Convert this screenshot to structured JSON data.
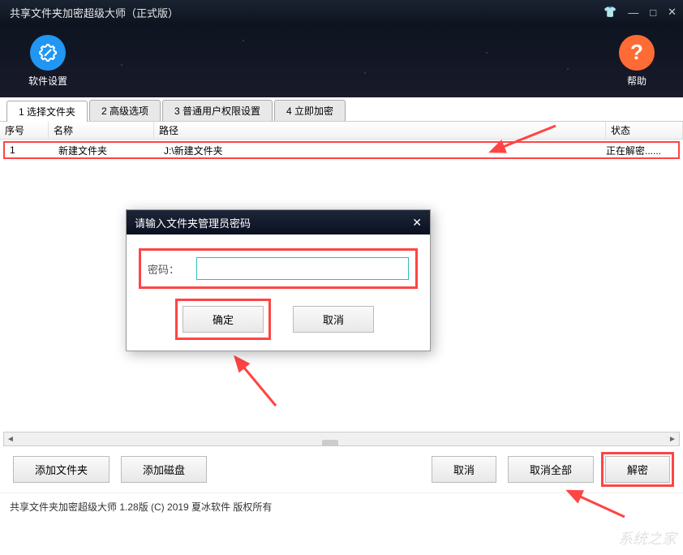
{
  "titlebar": {
    "title": "共享文件夹加密超级大师（正式版）"
  },
  "header": {
    "settings_label": "软件设置",
    "help_label": "帮助"
  },
  "tabs": [
    {
      "label": "1 选择文件夹",
      "active": true
    },
    {
      "label": "2 高级选项",
      "active": false
    },
    {
      "label": "3 普通用户权限设置",
      "active": false
    },
    {
      "label": "4 立即加密",
      "active": false
    }
  ],
  "table": {
    "headers": {
      "seq": "序号",
      "name": "名称",
      "path": "路径",
      "status": "状态"
    },
    "rows": [
      {
        "seq": "1",
        "name": "新建文件夹",
        "path": "J:\\新建文件夹",
        "status": "正在解密......"
      }
    ]
  },
  "dialog": {
    "title": "请输入文件夹管理员密码",
    "pw_label": "密码：",
    "ok": "确定",
    "cancel": "取消"
  },
  "bottom": {
    "add_folder": "添加文件夹",
    "add_disk": "添加磁盘",
    "cancel": "取消",
    "cancel_all": "取消全部",
    "decrypt": "解密"
  },
  "footer": {
    "text": "共享文件夹加密超级大师 1.28版  (C) 2019 夏冰软件 版权所有"
  },
  "watermark": "系统之家"
}
